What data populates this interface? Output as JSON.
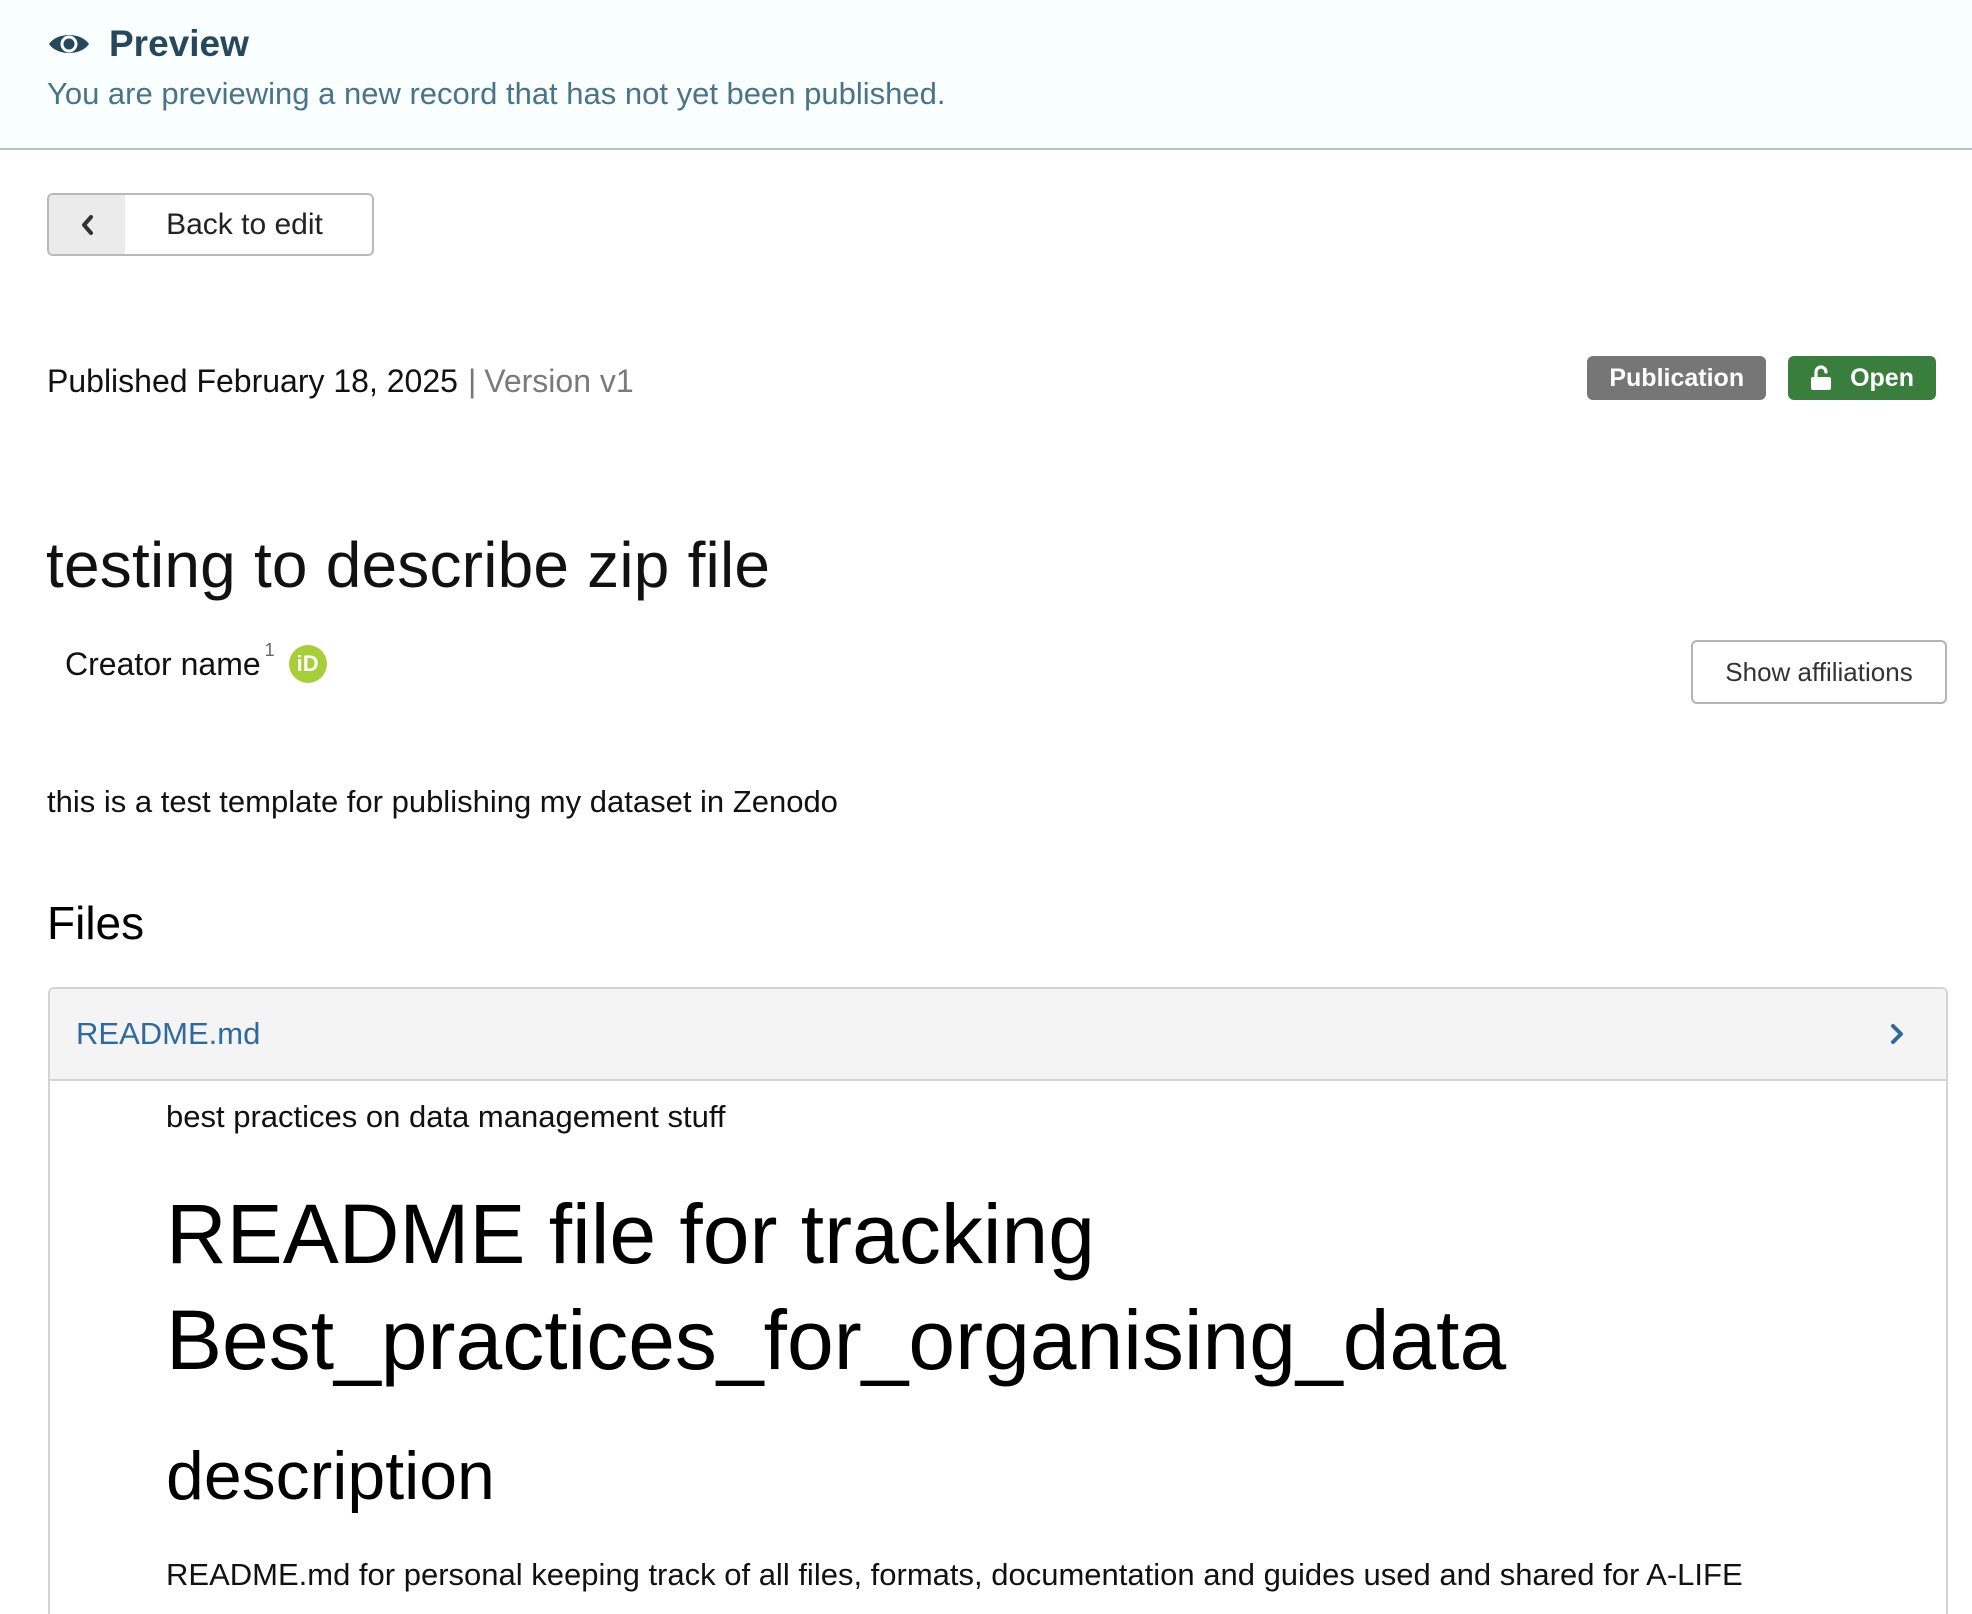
{
  "banner": {
    "title": "Preview",
    "description": "You are previewing a new record that has not yet been published."
  },
  "back_button": {
    "label": "Back to edit"
  },
  "meta": {
    "published": "Published February 18, 2025",
    "separator": "|",
    "version": "Version v1"
  },
  "badges": {
    "resource_type": "Publication",
    "access": "Open"
  },
  "record": {
    "title": "testing to describe zip file",
    "creator_name": "Creator name",
    "creator_affiliation_ref": "1",
    "orcid_label": "iD",
    "show_affiliations_label": "Show affiliations",
    "description": "this is a test template for publishing my dataset in Zenodo"
  },
  "files": {
    "heading": "Files",
    "file_name": "README.md",
    "preview": {
      "intro": "best practices on data management stuff",
      "h1": "README file for tracking Best_practices_for_organising_data",
      "h2": "description",
      "paragraph": "README.md for personal keeping track of all files, formats, documentation and guides used and shared for A-LIFE"
    }
  },
  "colors": {
    "banner_text": "#27485b",
    "banner_desc": "#4b7388",
    "badge_publication": "#767676",
    "badge_open": "#3a7e3d",
    "link_blue": "#2d6a9f",
    "orcid_green": "#a6ce39"
  },
  "icons": {
    "banner": "eye-icon",
    "back": "chevron-left-icon",
    "access": "lock-open-icon",
    "orcid": "orcid-icon",
    "file_expand": "chevron-right-icon"
  }
}
